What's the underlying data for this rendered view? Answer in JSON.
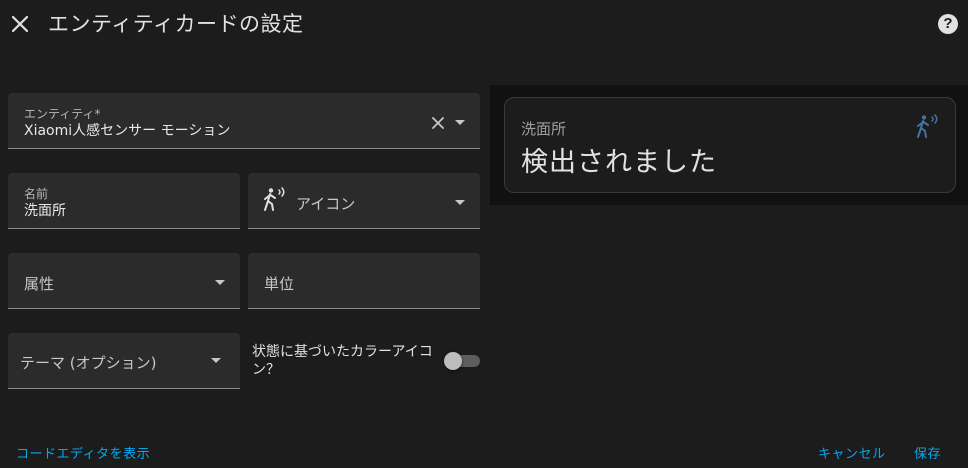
{
  "header": {
    "title": "エンティティカードの設定",
    "close_icon": "close-icon",
    "help_icon": "help-circle-icon",
    "help_glyph": "?"
  },
  "form": {
    "entity": {
      "label": "エンティティ*",
      "value": "Xiaomi人感センサー モーション"
    },
    "name": {
      "label": "名前",
      "value": "洗面所"
    },
    "icon": {
      "placeholder": "アイコン",
      "icon": "motion-sensor-icon"
    },
    "attribute": {
      "placeholder": "属性"
    },
    "unit": {
      "placeholder": "単位"
    },
    "theme": {
      "placeholder": "テーマ (オプション)"
    },
    "state_color": {
      "label": "状態に基づいたカラーアイコン？",
      "enabled": false
    }
  },
  "preview": {
    "name": "洗面所",
    "state": "検出されました",
    "icon": "motion-sensor-icon",
    "icon_color": "#44739e"
  },
  "footer": {
    "code_editor_link": "コードエディタを表示",
    "cancel": "キャンセル",
    "save": "保存"
  },
  "colors": {
    "accent": "#03a9f4",
    "background": "#1c1c1c",
    "field_background": "#2b2b2b"
  }
}
